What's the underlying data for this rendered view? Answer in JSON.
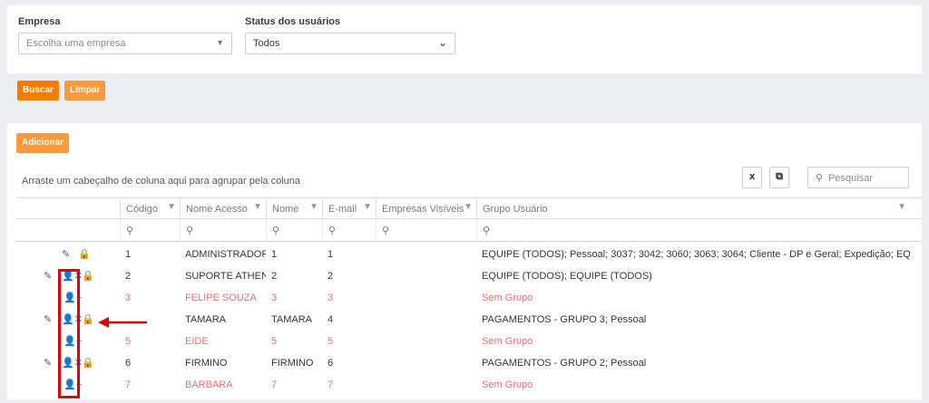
{
  "filters": {
    "empresa_label": "Empresa",
    "empresa_placeholder": "Escolha uma empresa",
    "status_label": "Status dos usuários",
    "status_value": "Todos"
  },
  "buttons": {
    "buscar": "Buscar",
    "limpar": "Limpar",
    "adicionar": "Adicionar"
  },
  "grid": {
    "group_hint": "Arraste um cabeçalho de coluna aqui para agrupar pela coluna",
    "search_placeholder": "Pesquisar",
    "columns": [
      "Código",
      "Nome Acesso",
      "Nome",
      "E-mail",
      "Empresas Visíveis",
      "Grupo Usuário"
    ],
    "rows": [
      {
        "codigo": "1",
        "nome_acesso": "ADMINISTRADOR",
        "nome": "1",
        "email": "1",
        "empresas": "",
        "grupo": "EQUIPE (TODOS); Pessoal; 3037; 3042; 3060; 3063; 3064; Cliente - DP e Geral; Expedição; EQUIPE (TODOS)",
        "actions": "edit-lock",
        "style": "normal"
      },
      {
        "codigo": "2",
        "nome_acesso": "SUPORTE ATHENAS",
        "nome": "2",
        "email": "2",
        "empresas": "",
        "grupo": "EQUIPE (TODOS); EQUIPE (TODOS)",
        "actions": "edit-remove-lock",
        "style": "normal"
      },
      {
        "codigo": "3",
        "nome_acesso": "FELIPE SOUZA",
        "nome": "3",
        "email": "3",
        "empresas": "",
        "grupo": "Sem Grupo",
        "actions": "add",
        "style": "red"
      },
      {
        "codigo": "",
        "nome_acesso": "TAMARA",
        "nome": "TAMARA",
        "email": "4",
        "empresas": "",
        "grupo": "PAGAMENTOS - GRUPO 3; Pessoal",
        "actions": "edit-remove-lock",
        "style": "normal"
      },
      {
        "codigo": "5",
        "nome_acesso": "EIDE",
        "nome": "5",
        "email": "5",
        "empresas": "",
        "grupo": "Sem Grupo",
        "actions": "add",
        "style": "red"
      },
      {
        "codigo": "6",
        "nome_acesso": "FIRMINO",
        "nome": "FIRMINO",
        "email": "6",
        "empresas": "",
        "grupo": "PAGAMENTOS - GRUPO 2; Pessoal",
        "actions": "edit-remove-lock",
        "style": "normal"
      },
      {
        "codigo": "7",
        "nome_acesso": "BARBARA",
        "nome": "7",
        "email": "7",
        "empresas": "",
        "grupo": "Sem Grupo",
        "actions": "add",
        "style": "red"
      }
    ]
  },
  "colors": {
    "accent": "#f57c00",
    "icon": "#5a4b9a",
    "highlight": "#e00000",
    "red_text": "#ef6b6b"
  }
}
